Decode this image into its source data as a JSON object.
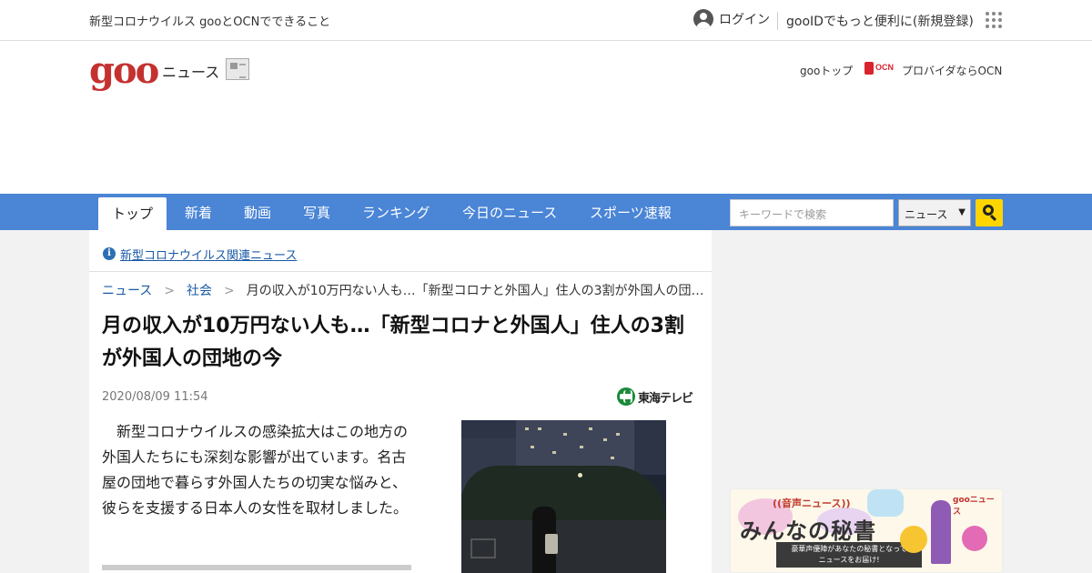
{
  "topbar": {
    "promo": "新型コロナウイルス gooとOCNでできること",
    "login": "ログイン",
    "signup": "gooIDでもっと便利に(新規登録)"
  },
  "header": {
    "logo": "goo",
    "section": "ニュース",
    "goo_top": "gooトップ",
    "ocn_mark": "OCN",
    "ocn_text": "プロバイダならOCN"
  },
  "nav": {
    "tabs": [
      "トップ",
      "新着",
      "動画",
      "写真",
      "ランキング",
      "今日のニュース",
      "スポーツ速報"
    ],
    "search_placeholder": "キーワードで検索",
    "search_scope": "ニュース"
  },
  "notice": {
    "link": "新型コロナウイルス関連ニュース"
  },
  "breadcrumb": [
    "ニュース",
    "社会",
    "月の収入が10万円ない人も…「新型コロナと外国人」住人の3割が外国人の団…"
  ],
  "article": {
    "title": "月の収入が10万円ない人も…「新型コロナと外国人」住人の3割が外国人の団地の今",
    "date": "2020/08/09 11:54",
    "source": "東海テレビ",
    "lead": "新型コロナウイルスの感染拡大はこの地方の外国人たちにも深刻な影響が出ています。名古屋の団地で暮らす外国人たちの切実な悩みと、彼らを支援する日本人の女性を取材しました。"
  },
  "side_ad": {
    "kicker": "((音声ニュース))",
    "brand": "gooニュース",
    "headline": "みんなの秘書",
    "sub_line1": "豪華声優陣があなたの秘書となって",
    "sub_line2": "ニュースをお届け!"
  },
  "colors": {
    "nav_blue": "#4a85d6",
    "logo_red": "#c4312f",
    "link_blue": "#1a5aa6",
    "search_yellow": "#ffd500"
  }
}
